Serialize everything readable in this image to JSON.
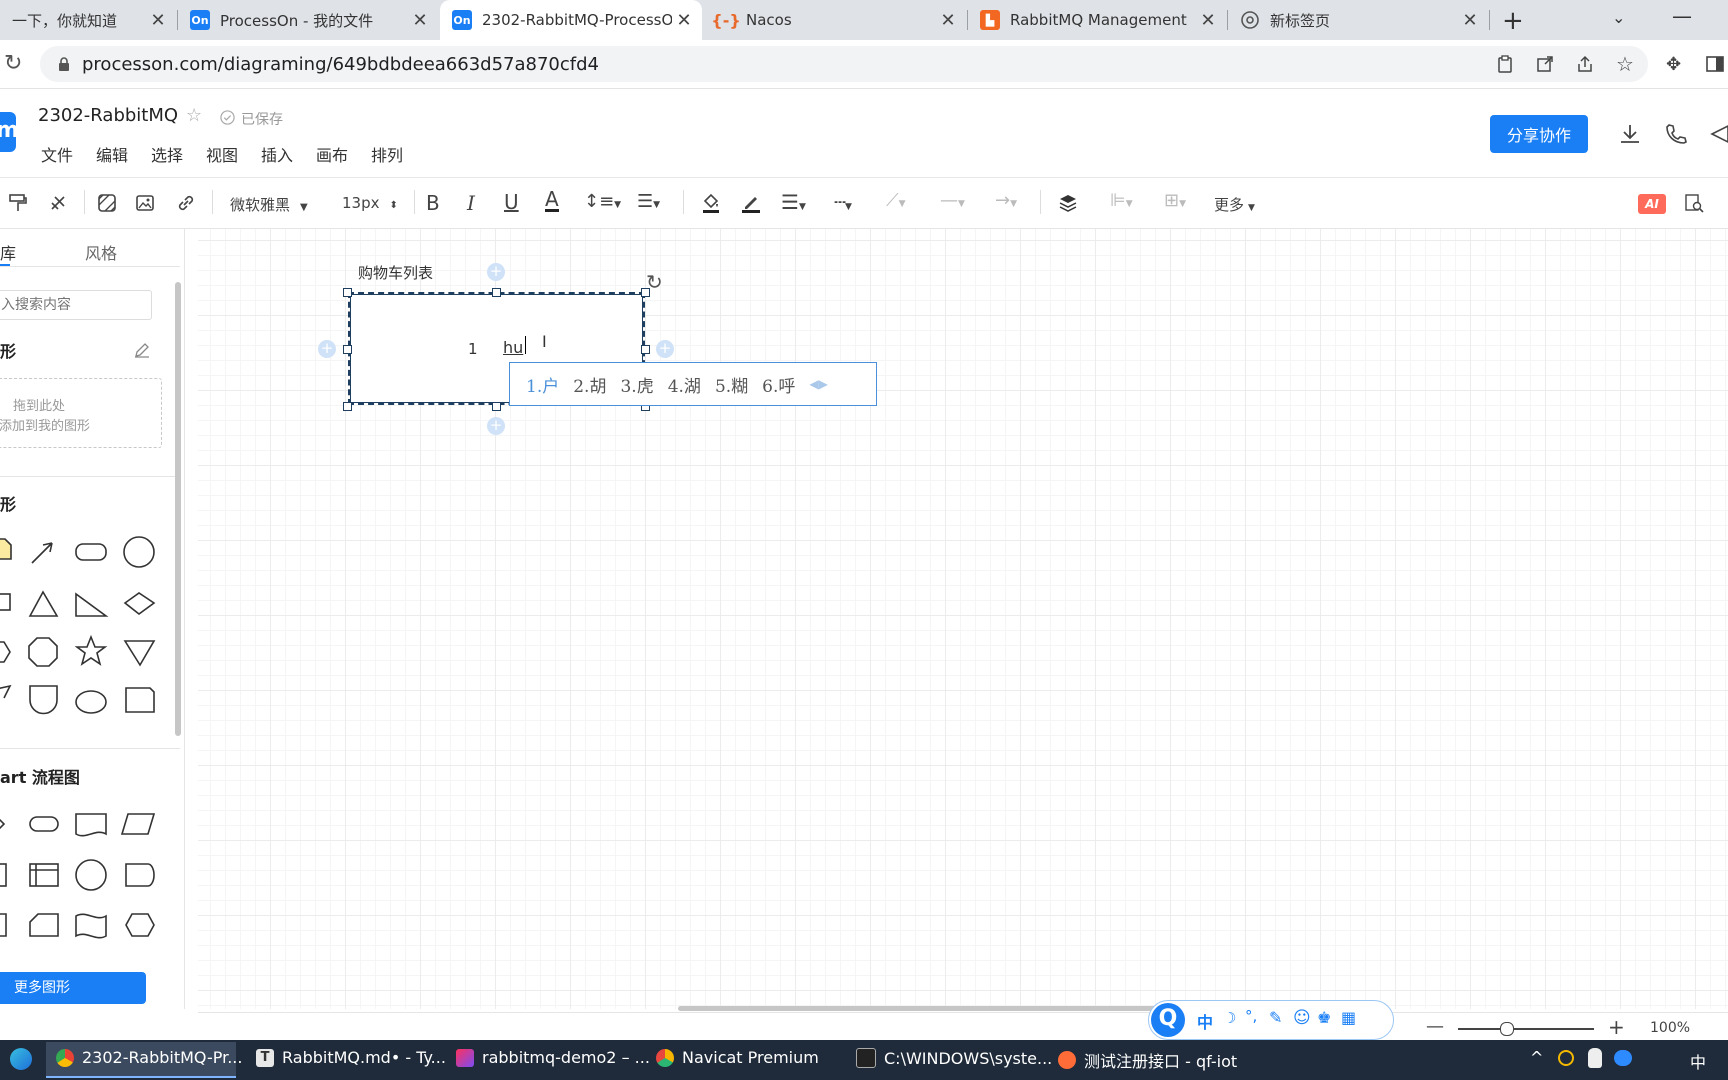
{
  "browser": {
    "tabs": [
      {
        "title": "一下，你就知道",
        "active": false
      },
      {
        "title": "ProcessOn - 我的文件",
        "favicon": "On",
        "active": false
      },
      {
        "title": "2302-RabbitMQ-ProcessOn",
        "favicon": "On",
        "active": true
      },
      {
        "title": "Nacos",
        "active": false
      },
      {
        "title": "RabbitMQ Management",
        "active": false
      },
      {
        "title": "新标签页",
        "active": false
      }
    ],
    "url": "processon.com/diagraming/649bdbdeea663d57a870cfd4"
  },
  "app": {
    "logo_letter": "m",
    "doc_title": "2302-RabbitMQ",
    "save_status": "已保存",
    "menus": [
      "文件",
      "编辑",
      "选择",
      "视图",
      "插入",
      "画布",
      "排列"
    ],
    "share_button": "分享协作"
  },
  "toolbar": {
    "font_family": "微软雅黑",
    "font_size": "13px",
    "more_label": "更多",
    "ai_label": "AI"
  },
  "left_panel": {
    "tabs": [
      "库",
      "风格"
    ],
    "search_placeholder": "入搜索内容",
    "my_shapes_title": "形",
    "drop_hint_line1": "拖到此处",
    "drop_hint_line2": "添加到我的图形",
    "basic_title": "形",
    "flowchart_title": "art 流程图",
    "more_shapes_button": "更多图形"
  },
  "canvas": {
    "label": "购物车列表",
    "row_number": "1",
    "typed_text": "hu",
    "ime_candidates": [
      "1.户",
      "2.胡",
      "3.虎",
      "4.湖",
      "5.糊",
      "6.呼"
    ]
  },
  "status": {
    "zoom": "100%",
    "ime_mode": "中"
  },
  "taskbar": {
    "items": [
      "2302-RabbitMQ-Pr...",
      "RabbitMQ.md• - Ty...",
      "rabbitmq-demo2 – ...",
      "Navicat Premium",
      "C:\\WINDOWS\\syste...",
      "测试注册接口 - qf-iot"
    ],
    "ime": "中"
  },
  "colors": {
    "accent": "#1a7ff5",
    "tab_strip": "#dfe3e8",
    "selection_border": "#1f3f60",
    "ime_text": "#4a90d9",
    "taskbar": "#1f2b3a"
  }
}
